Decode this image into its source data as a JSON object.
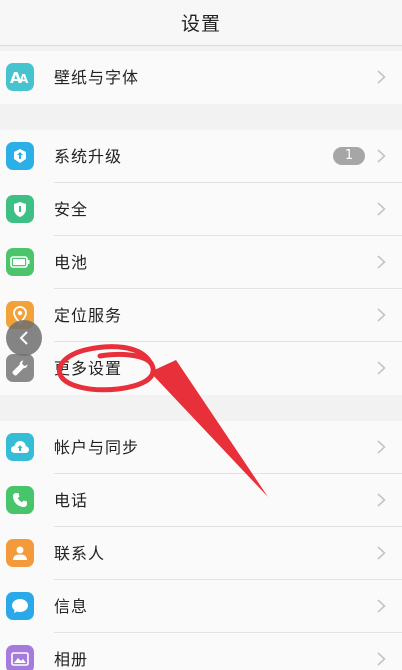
{
  "header": {
    "title": "设置"
  },
  "groups": [
    {
      "items": [
        {
          "label": "壁纸与字体",
          "icon": "font-icon",
          "color": "#45c4cf"
        }
      ]
    },
    {
      "items": [
        {
          "label": "系统升级",
          "icon": "system-upgrade-icon",
          "color": "#2ab0e6",
          "badge": "1"
        },
        {
          "label": "安全",
          "icon": "security-shield-icon",
          "color": "#3dbf86"
        },
        {
          "label": "电池",
          "icon": "battery-icon",
          "color": "#4cc46b"
        },
        {
          "label": "定位服务",
          "icon": "location-icon",
          "color": "#f3a23a"
        },
        {
          "label": "更多设置",
          "icon": "wrench-icon",
          "color": "#8a8a8a"
        }
      ]
    },
    {
      "items": [
        {
          "label": "帐户与同步",
          "icon": "cloud-sync-icon",
          "color": "#35bcd6"
        },
        {
          "label": "电话",
          "icon": "phone-icon",
          "color": "#48c56a"
        },
        {
          "label": "联系人",
          "icon": "contacts-icon",
          "color": "#f39a3a"
        },
        {
          "label": "信息",
          "icon": "message-icon",
          "color": "#2aa8e8"
        },
        {
          "label": "相册",
          "icon": "album-icon",
          "color": "#a57be0"
        }
      ]
    }
  ],
  "annotation_color": "#e8303a"
}
